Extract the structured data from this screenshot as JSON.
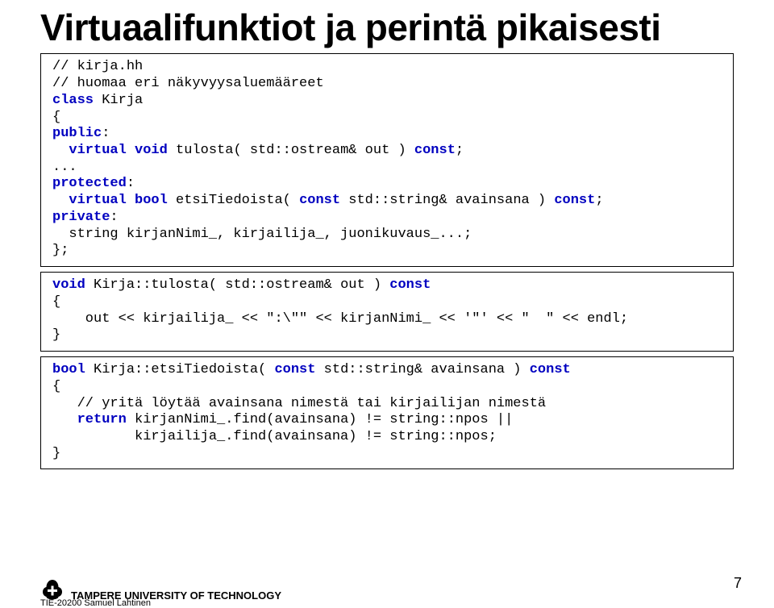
{
  "title": "Virtuaalifunktiot ja perintä pikaisesti",
  "code1": {
    "l1": "// kirja.hh",
    "l2": "// huomaa eri näkyvyysaluemääreet",
    "l3a": "class",
    "l3b": " Kirja",
    "l4": "{",
    "l5a": "public",
    "l5b": ":",
    "l6a": "  virtual void",
    "l6b": " tulosta( std::ostream& out ) ",
    "l6c": "const",
    "l6d": ";",
    "l7": "...",
    "l8a": "protected",
    "l8b": ":",
    "l9a": "  virtual bool",
    "l9b": " etsiTiedoista( ",
    "l9c": "const",
    "l9d": " std::string& avainsana ) ",
    "l9e": "const",
    "l9f": ";",
    "l10a": "private",
    "l10b": ":",
    "l11": "  string kirjanNimi_, kirjailija_, juonikuvaus_...;",
    "l12": "};"
  },
  "code2": {
    "l1a": "void",
    "l1b": " Kirja::tulosta( std::ostream& out ) ",
    "l1c": "const",
    "l2": "{",
    "l3": "    out << kirjailija_ << \":\\\"\" << kirjanNimi_ << '\"' << \"  \" << endl;",
    "l4": "}"
  },
  "code3": {
    "l1a": "bool",
    "l1b": " Kirja::etsiTiedoista( ",
    "l1c": "const",
    "l1d": " std::string& avainsana ) ",
    "l1e": "const",
    "l2": "{",
    "l3": "   // yritä löytää avainsana nimestä tai kirjailijan nimestä",
    "l4a": "   return",
    "l4b": " kirjanNimi_.find(avainsana) != string::npos ||",
    "l5": "          kirjailija_.find(avainsana) != string::npos;",
    "l6": "}"
  },
  "footer": {
    "uni": "TAMPERE UNIVERSITY OF TECHNOLOGY",
    "course": "TIE-20200 Samuel Lahtinen",
    "page": "7"
  }
}
